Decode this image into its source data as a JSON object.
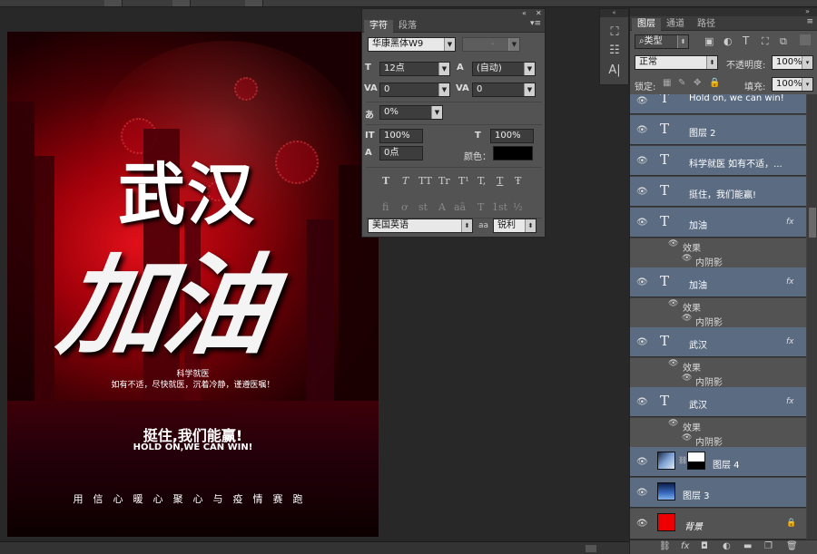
{
  "poster": {
    "line_wuhan": "武汉",
    "line_jiayou": "加油",
    "science": "科学就医",
    "advice": "如有不适，尽快就医，沉着冷静，谨遵医嘱！",
    "slogan_cn": "挺住,我们能赢!",
    "slogan_en": "HOLD ON,WE CAN WIN!",
    "footer": "用信心暖心聚心与疫情赛跑"
  },
  "character_panel": {
    "tabs": [
      "字符",
      "段落"
    ],
    "font_family": "华康黑体W9",
    "font_style": "-",
    "font_size": "12点",
    "leading": "(自动)",
    "kerning": "0",
    "tracking": "0",
    "tsume": "0%",
    "vscale": "100%",
    "hscale": "100%",
    "baseline": "0点",
    "color_label": "颜色：",
    "language": "美国英语",
    "aa_label": "aa",
    "antialias": "锐利",
    "style_buttons": [
      "T",
      "T",
      "TT",
      "Tr",
      "T¹",
      "T,",
      "T",
      "Ŧ"
    ],
    "ot_buttons": [
      "fi",
      "ơ",
      "st",
      "A",
      "aā",
      "T",
      "1st",
      "½"
    ]
  },
  "layers_panel": {
    "tabs": [
      "图层",
      "通道",
      "路径"
    ],
    "filter": "类型",
    "blend_mode": "正常",
    "opacity_label": "不透明度:",
    "opacity": "100%",
    "lock_label": "锁定:",
    "fill_label": "填充:",
    "fill": "100%",
    "layers": [
      {
        "name": "Hold on, we can win!",
        "type": "text",
        "fx": false
      },
      {
        "name": "图层 2",
        "type": "text",
        "fx": false
      },
      {
        "name": "科学就医 如有不适，...",
        "type": "text",
        "fx": false
      },
      {
        "name": "挺住，我们能赢!",
        "type": "text",
        "fx": false
      },
      {
        "name": "加油",
        "type": "text",
        "fx": true,
        "effects_label": "效果",
        "effect": "内阴影"
      },
      {
        "name": "加油",
        "type": "text",
        "fx": true,
        "effects_label": "效果",
        "effect": "内阴影"
      },
      {
        "name": "武汉",
        "type": "text",
        "fx": true,
        "effects_label": "效果",
        "effect": "内阴影"
      },
      {
        "name": "武汉",
        "type": "text",
        "fx": true,
        "effects_label": "效果",
        "effect": "内阴影"
      },
      {
        "name": "图层 4",
        "type": "image-mask"
      },
      {
        "name": "图层 3",
        "type": "image"
      },
      {
        "name": "背景",
        "type": "background"
      }
    ],
    "fx_symbol": "fx"
  },
  "colors": {
    "accent_selected": "#5a6b82",
    "poster_red": "#e0101a",
    "background_swatch": "#ee0000"
  }
}
